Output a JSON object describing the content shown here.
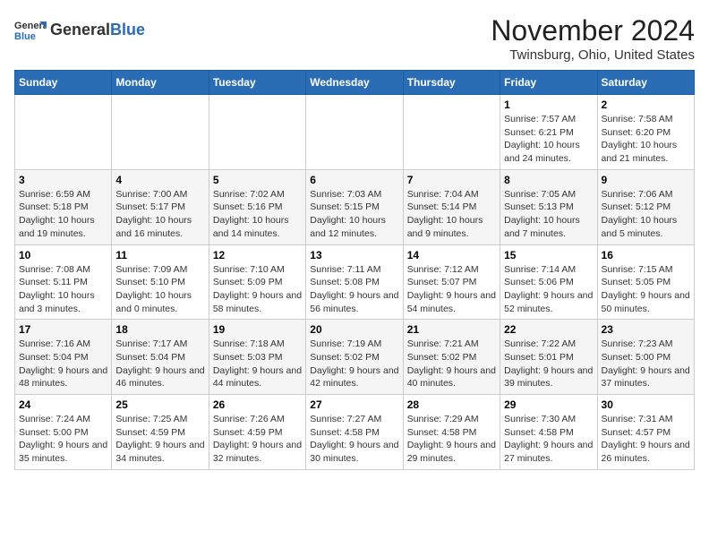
{
  "header": {
    "logo_general": "General",
    "logo_blue": "Blue",
    "month_title": "November 2024",
    "location": "Twinsburg, Ohio, United States"
  },
  "weekdays": [
    "Sunday",
    "Monday",
    "Tuesday",
    "Wednesday",
    "Thursday",
    "Friday",
    "Saturday"
  ],
  "weeks": [
    [
      {
        "day": "",
        "info": ""
      },
      {
        "day": "",
        "info": ""
      },
      {
        "day": "",
        "info": ""
      },
      {
        "day": "",
        "info": ""
      },
      {
        "day": "",
        "info": ""
      },
      {
        "day": "1",
        "info": "Sunrise: 7:57 AM\nSunset: 6:21 PM\nDaylight: 10 hours and 24 minutes."
      },
      {
        "day": "2",
        "info": "Sunrise: 7:58 AM\nSunset: 6:20 PM\nDaylight: 10 hours and 21 minutes."
      }
    ],
    [
      {
        "day": "3",
        "info": "Sunrise: 6:59 AM\nSunset: 5:18 PM\nDaylight: 10 hours and 19 minutes."
      },
      {
        "day": "4",
        "info": "Sunrise: 7:00 AM\nSunset: 5:17 PM\nDaylight: 10 hours and 16 minutes."
      },
      {
        "day": "5",
        "info": "Sunrise: 7:02 AM\nSunset: 5:16 PM\nDaylight: 10 hours and 14 minutes."
      },
      {
        "day": "6",
        "info": "Sunrise: 7:03 AM\nSunset: 5:15 PM\nDaylight: 10 hours and 12 minutes."
      },
      {
        "day": "7",
        "info": "Sunrise: 7:04 AM\nSunset: 5:14 PM\nDaylight: 10 hours and 9 minutes."
      },
      {
        "day": "8",
        "info": "Sunrise: 7:05 AM\nSunset: 5:13 PM\nDaylight: 10 hours and 7 minutes."
      },
      {
        "day": "9",
        "info": "Sunrise: 7:06 AM\nSunset: 5:12 PM\nDaylight: 10 hours and 5 minutes."
      }
    ],
    [
      {
        "day": "10",
        "info": "Sunrise: 7:08 AM\nSunset: 5:11 PM\nDaylight: 10 hours and 3 minutes."
      },
      {
        "day": "11",
        "info": "Sunrise: 7:09 AM\nSunset: 5:10 PM\nDaylight: 10 hours and 0 minutes."
      },
      {
        "day": "12",
        "info": "Sunrise: 7:10 AM\nSunset: 5:09 PM\nDaylight: 9 hours and 58 minutes."
      },
      {
        "day": "13",
        "info": "Sunrise: 7:11 AM\nSunset: 5:08 PM\nDaylight: 9 hours and 56 minutes."
      },
      {
        "day": "14",
        "info": "Sunrise: 7:12 AM\nSunset: 5:07 PM\nDaylight: 9 hours and 54 minutes."
      },
      {
        "day": "15",
        "info": "Sunrise: 7:14 AM\nSunset: 5:06 PM\nDaylight: 9 hours and 52 minutes."
      },
      {
        "day": "16",
        "info": "Sunrise: 7:15 AM\nSunset: 5:05 PM\nDaylight: 9 hours and 50 minutes."
      }
    ],
    [
      {
        "day": "17",
        "info": "Sunrise: 7:16 AM\nSunset: 5:04 PM\nDaylight: 9 hours and 48 minutes."
      },
      {
        "day": "18",
        "info": "Sunrise: 7:17 AM\nSunset: 5:04 PM\nDaylight: 9 hours and 46 minutes."
      },
      {
        "day": "19",
        "info": "Sunrise: 7:18 AM\nSunset: 5:03 PM\nDaylight: 9 hours and 44 minutes."
      },
      {
        "day": "20",
        "info": "Sunrise: 7:19 AM\nSunset: 5:02 PM\nDaylight: 9 hours and 42 minutes."
      },
      {
        "day": "21",
        "info": "Sunrise: 7:21 AM\nSunset: 5:02 PM\nDaylight: 9 hours and 40 minutes."
      },
      {
        "day": "22",
        "info": "Sunrise: 7:22 AM\nSunset: 5:01 PM\nDaylight: 9 hours and 39 minutes."
      },
      {
        "day": "23",
        "info": "Sunrise: 7:23 AM\nSunset: 5:00 PM\nDaylight: 9 hours and 37 minutes."
      }
    ],
    [
      {
        "day": "24",
        "info": "Sunrise: 7:24 AM\nSunset: 5:00 PM\nDaylight: 9 hours and 35 minutes."
      },
      {
        "day": "25",
        "info": "Sunrise: 7:25 AM\nSunset: 4:59 PM\nDaylight: 9 hours and 34 minutes."
      },
      {
        "day": "26",
        "info": "Sunrise: 7:26 AM\nSunset: 4:59 PM\nDaylight: 9 hours and 32 minutes."
      },
      {
        "day": "27",
        "info": "Sunrise: 7:27 AM\nSunset: 4:58 PM\nDaylight: 9 hours and 30 minutes."
      },
      {
        "day": "28",
        "info": "Sunrise: 7:29 AM\nSunset: 4:58 PM\nDaylight: 9 hours and 29 minutes."
      },
      {
        "day": "29",
        "info": "Sunrise: 7:30 AM\nSunset: 4:58 PM\nDaylight: 9 hours and 27 minutes."
      },
      {
        "day": "30",
        "info": "Sunrise: 7:31 AM\nSunset: 4:57 PM\nDaylight: 9 hours and 26 minutes."
      }
    ]
  ]
}
